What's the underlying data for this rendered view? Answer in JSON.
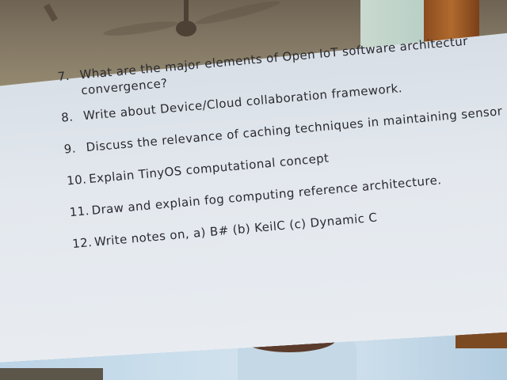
{
  "questions": [
    {
      "number": "7.",
      "text": "What are the major elements of Open IoT software architectur",
      "continuation": "convergence?"
    },
    {
      "number": "8.",
      "text": "Write about Device/Cloud collaboration framework."
    },
    {
      "number": "9.",
      "text": "Discuss the relevance of caching techniques in maintaining sensor"
    },
    {
      "number": "10.",
      "text": "Explain TinyOS computational concept"
    },
    {
      "number": "11.",
      "text": "Draw and explain fog computing reference architecture."
    },
    {
      "number": "12.",
      "text": "Write notes on, a) B# (b) KeilC  (c) Dynamic C"
    }
  ]
}
